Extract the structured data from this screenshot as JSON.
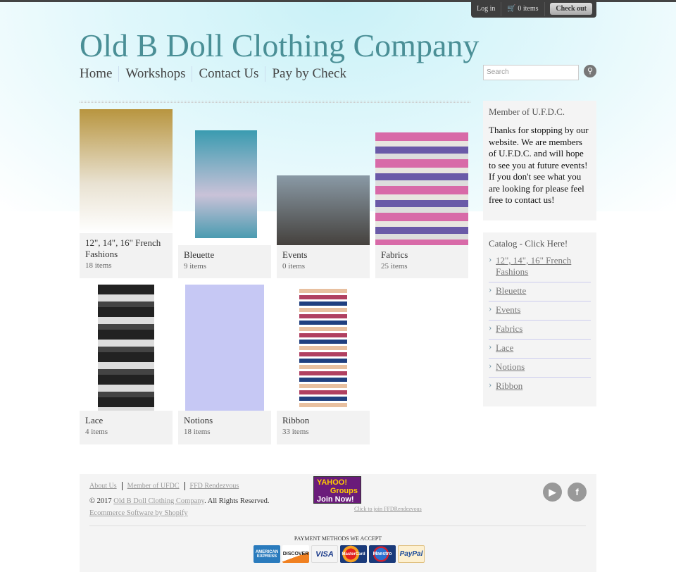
{
  "topbar": {
    "login": "Log in",
    "cart": "0 items",
    "checkout": "Check out"
  },
  "header": {
    "title": "Old B Doll Clothing Company",
    "nav": [
      "Home",
      "Workshops",
      "Contact Us",
      "Pay by Check"
    ],
    "search_placeholder": "Search"
  },
  "products": [
    {
      "name": "12\", 14\", 16\" French Fashions",
      "count": "18 items"
    },
    {
      "name": "Bleuette",
      "count": "9 items"
    },
    {
      "name": "Events",
      "count": "0 items"
    },
    {
      "name": "Fabrics",
      "count": "25 items"
    },
    {
      "name": "Lace",
      "count": "4 items"
    },
    {
      "name": "Notions",
      "count": "18 items"
    },
    {
      "name": "Ribbon",
      "count": "33 items"
    }
  ],
  "sidebar": {
    "member_title": "Member of U.F.D.C.",
    "member_text": "Thanks for stopping by our website. We are members of U.F.D.C. and will hope to see you at future events! If you don't see what you are looking for please feel free to contact us!",
    "catalog_title": "Catalog - Click Here!",
    "catalog": [
      "12\", 14\", 16\" French Fashions",
      "Bleuette",
      "Events",
      "Fabrics",
      "Lace",
      "Notions",
      "Ribbon"
    ]
  },
  "footer": {
    "links": [
      "About Us",
      "Member of UFDC",
      "FFD Rendezvous"
    ],
    "copy_prefix": "© 2017 ",
    "copy_link": "Old B Doll Clothing Company",
    "copy_suffix": ". All Rights Reserved.",
    "shopify": "Ecommerce Software by Shopify",
    "yahoo": {
      "line1": "YAHOO!",
      "line2": "Groups",
      "line3": "Join Now!"
    },
    "yahoo_link": "Click to join FFDRendezvous",
    "payment_title": "PAYMENT METHODS WE ACCEPT",
    "payments": [
      "AMERICAN EXPRESS",
      "DISCOVER",
      "VISA",
      "MasterCard",
      "Maestro",
      "PayPal"
    ]
  },
  "colors": {
    "title": "#4a8f96",
    "topbar": "#3e3e3e"
  }
}
